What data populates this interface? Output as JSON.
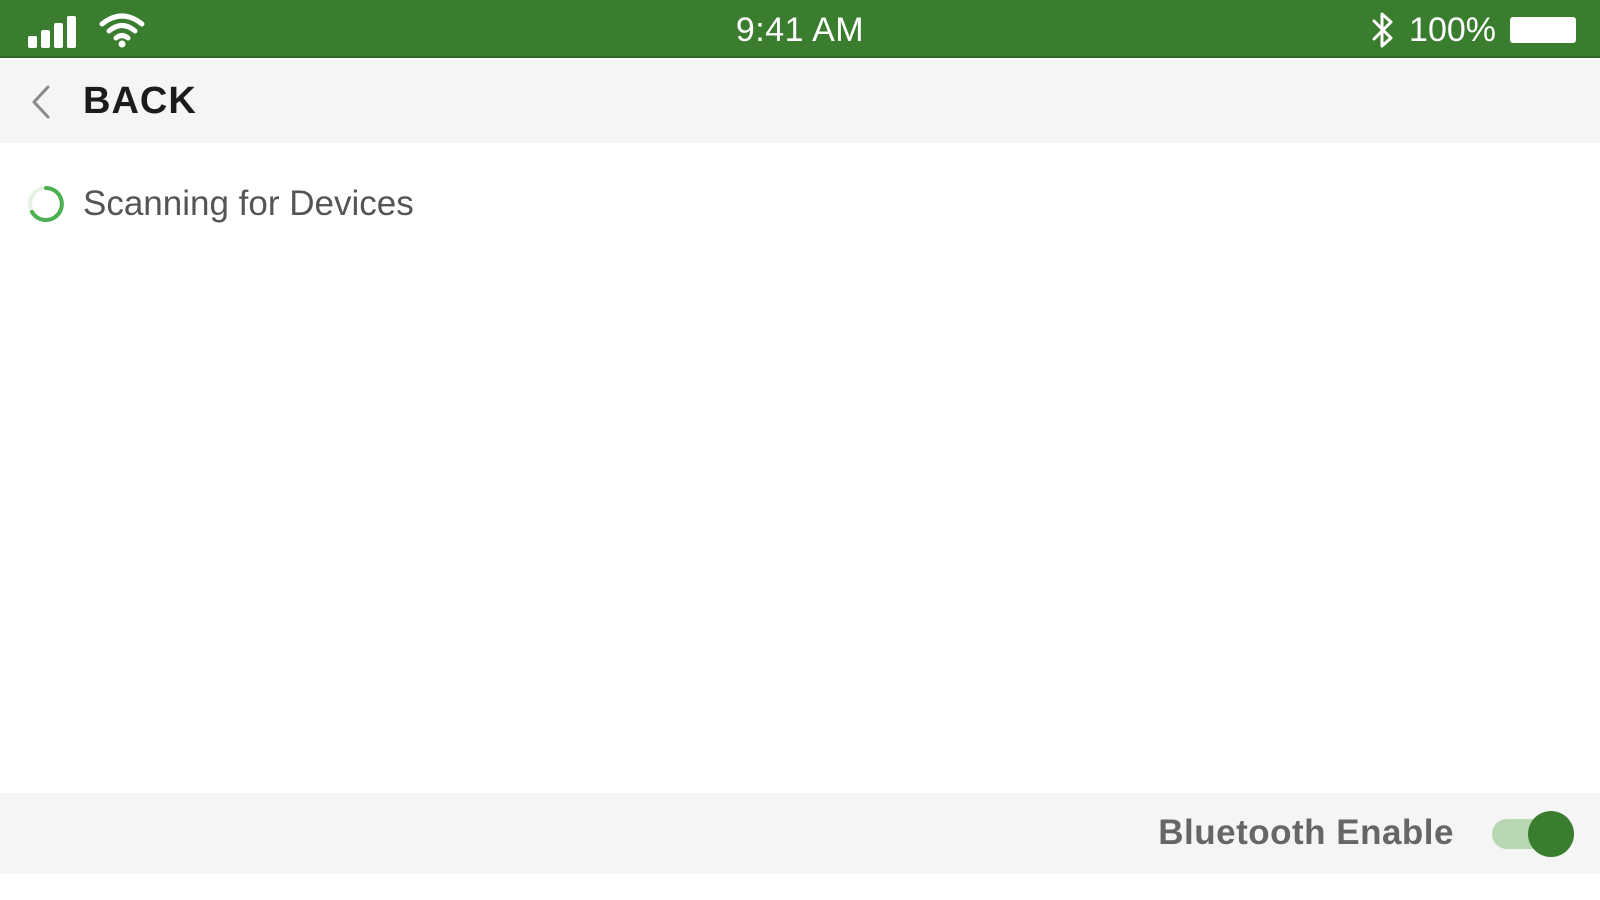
{
  "status_bar": {
    "time": "9:41 AM",
    "battery_percent": "100%",
    "icons": [
      "signal-icon",
      "wifi-icon",
      "bluetooth-icon",
      "battery-icon"
    ],
    "background_color": "#3a7d2f"
  },
  "nav": {
    "back_label": "BACK",
    "back_icon": "chevron-left-icon"
  },
  "main": {
    "scan_status": "Scanning for Devices",
    "spinner_icon": "loading-spinner-icon",
    "spinner_color": "#4caf50"
  },
  "footer": {
    "bluetooth_label": "Bluetooth Enable",
    "bluetooth_enabled": true,
    "toggle_color": "#3a7d2f"
  }
}
